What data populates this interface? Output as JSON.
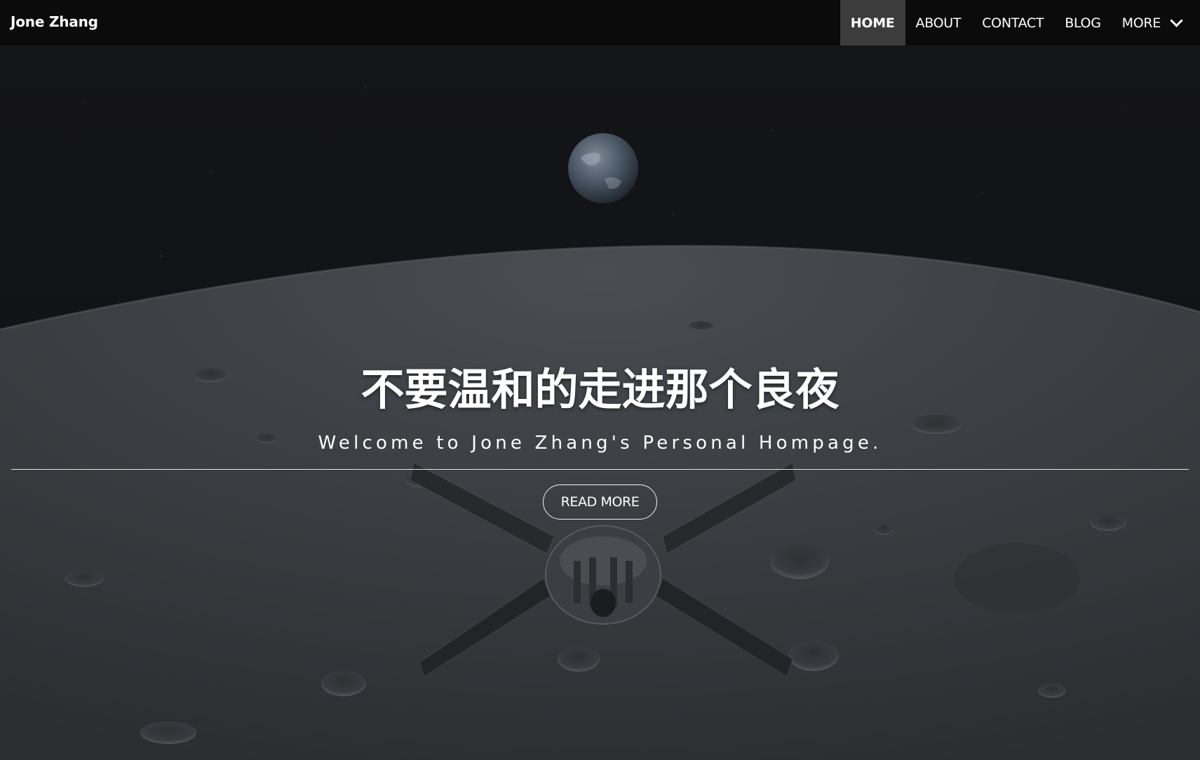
{
  "navbar": {
    "brand": "Jone Zhang",
    "items": [
      {
        "label": "HOME",
        "active": true
      },
      {
        "label": "ABOUT",
        "active": false
      },
      {
        "label": "CONTACT",
        "active": false
      },
      {
        "label": "BLOG",
        "active": false
      },
      {
        "label": "MORE",
        "active": false,
        "icon": "chevron-down-icon"
      }
    ]
  },
  "hero": {
    "title": "不要温和的走进那个良夜",
    "subtitle": "Welcome to Jone Zhang's Personal Hompage.",
    "button_label": "READ MORE",
    "background": "earth-rising-over-moon-with-spacecraft-image"
  },
  "colors": {
    "navbar_bg": "#0b0b0c",
    "active_item_bg": "#3c3c3d",
    "text": "#ffffff",
    "space": "#111214",
    "moon_surface": "#3c4044"
  }
}
